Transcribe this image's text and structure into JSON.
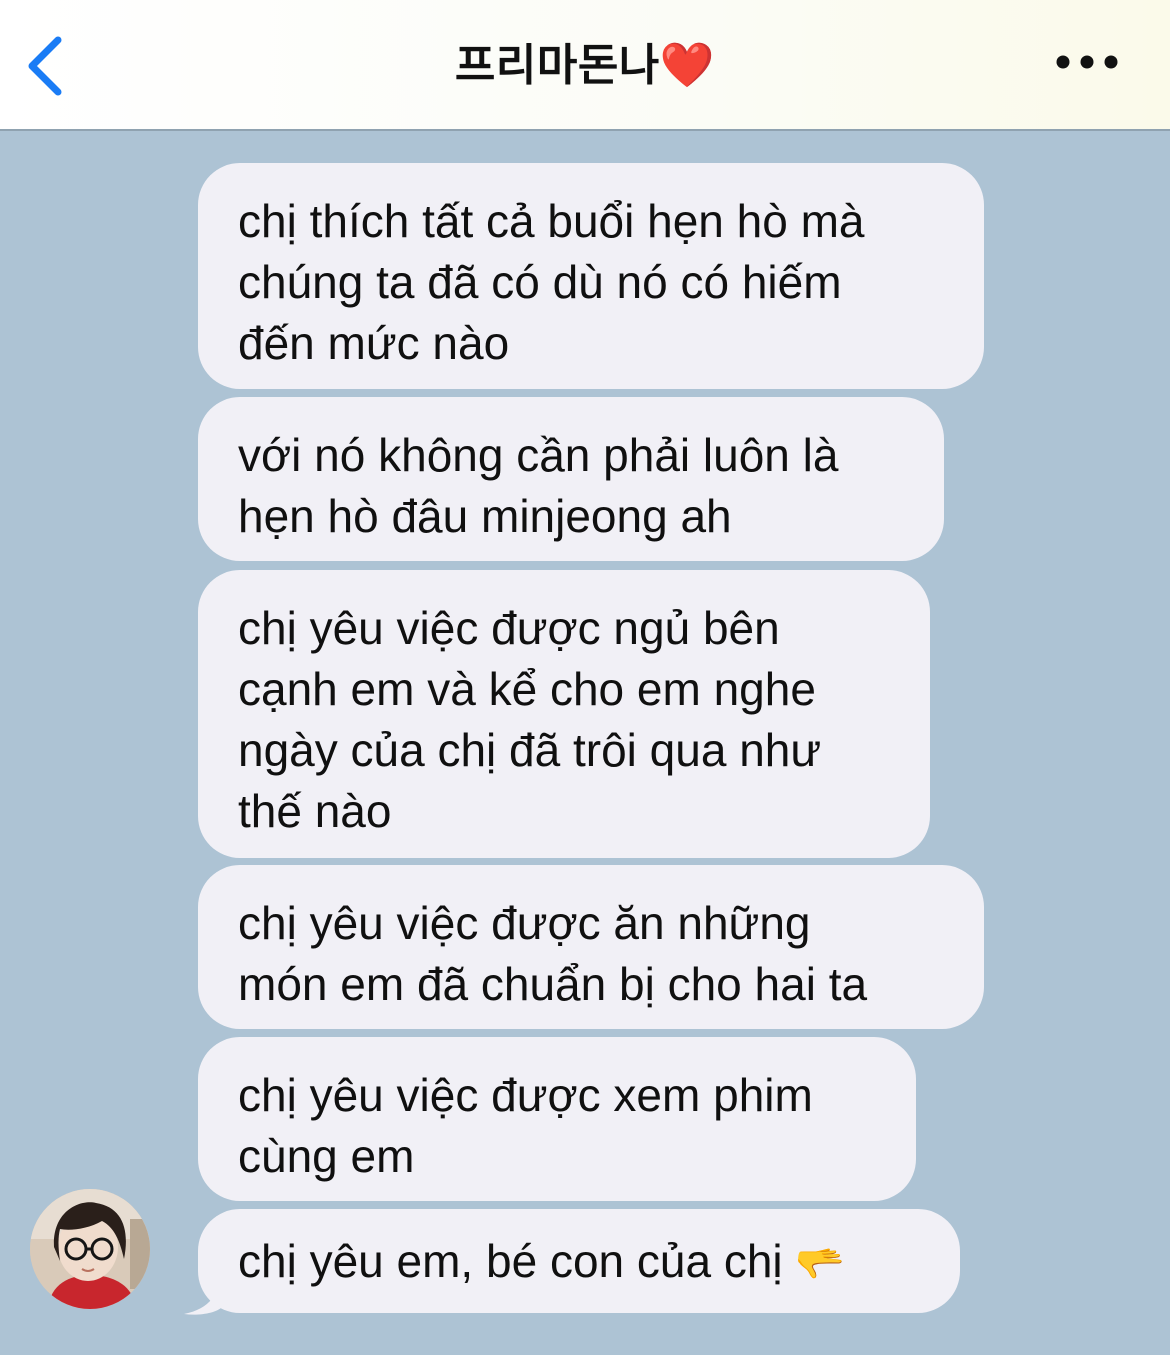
{
  "header": {
    "back_icon": "chevron-left-icon",
    "title": "프리마돈나",
    "title_emoji": "❤️",
    "more_icon": "ellipsis-icon"
  },
  "messages": [
    {
      "text": "chị thích tất cả buổi hẹn hò mà\nchúng ta đã có dù nó có hiếm\nđến mức nào"
    },
    {
      "text": "với nó không cần phải luôn là\nhẹn hò đâu minjeong ah"
    },
    {
      "text": "chị yêu việc được ngủ bên\ncạnh em và kể cho em nghe\nngày của chị đã trôi qua như\nthế nào"
    },
    {
      "text": "chị yêu việc được ăn những\nmón em đã chuẩn bị cho hai ta"
    },
    {
      "text": "chị yêu việc được xem phim\ncùng em"
    },
    {
      "text": "chị yêu em, bé con của chị",
      "emoji": "🫳"
    }
  ],
  "colors": {
    "accent": "#1a7cf5",
    "chat_background": "#adc3d4",
    "bubble_background": "#f1f0f6",
    "heart": "#e0242e"
  }
}
